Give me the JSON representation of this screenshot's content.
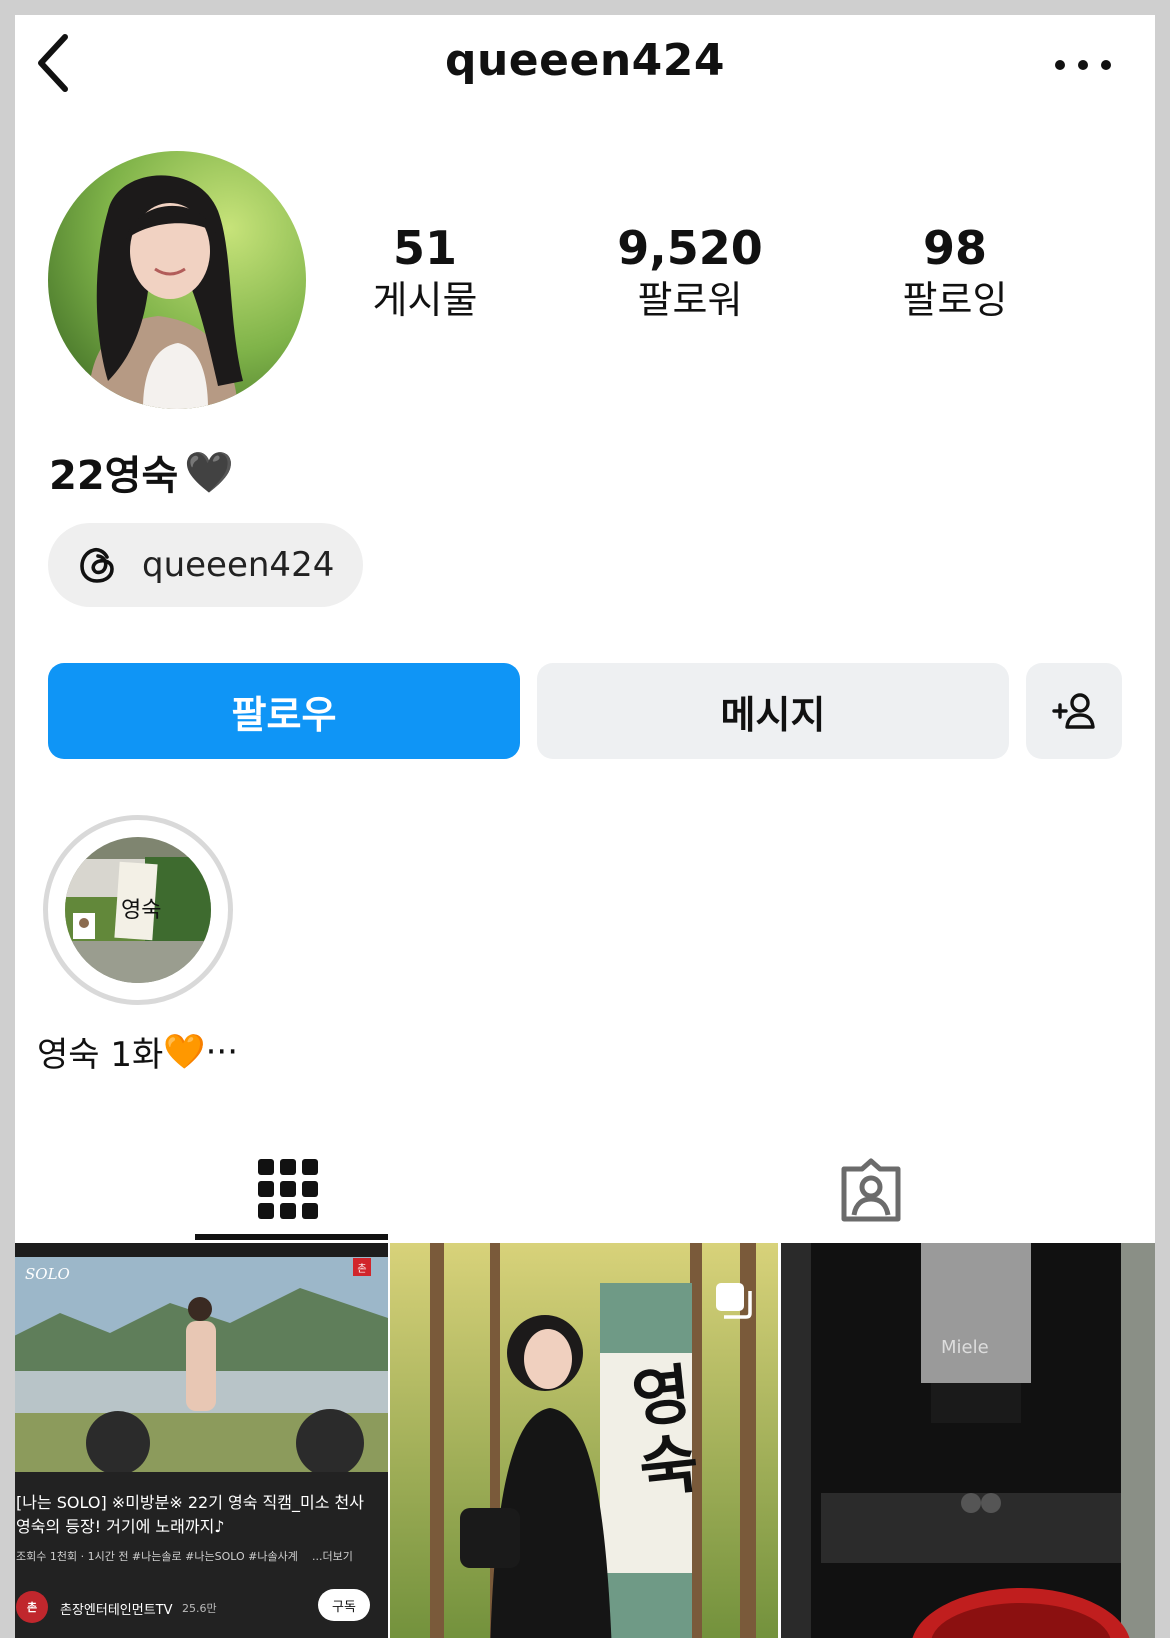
{
  "header": {
    "username": "queeen424"
  },
  "stats": [
    {
      "value": "51",
      "label": "게시물"
    },
    {
      "value": "9,520",
      "label": "팔로워"
    },
    {
      "value": "98",
      "label": "팔로잉"
    }
  ],
  "profile": {
    "display_name": "22영숙",
    "name_emoji": "🖤",
    "threads_handle": "queeen424"
  },
  "actions": {
    "follow_label": "팔로우",
    "message_label": "메시지"
  },
  "highlight": {
    "label": "영숙 1화",
    "emoji": "🧡",
    "ellipsis": "···",
    "signboard_text": "영숙"
  },
  "posts": [
    {
      "type": "video-screenshot",
      "show_logo": "SOLO",
      "channel_badge": "촌",
      "title": "[나는 SOLO] ※미방분※ 22기 영숙 직캠_미소 천사 영숙의 등장! 거기에 노래까지♪",
      "meta": "조회수 1천회 · 1시간 전   #나는솔로 #나는SOLO #나솔사계",
      "more": "...더보기",
      "channel_logo": "촌",
      "channel_name": "촌장엔터테인먼트TV",
      "subscribers": "25.6만",
      "subscribe_label": "구독"
    },
    {
      "type": "carousel",
      "banner_text": "영숙"
    },
    {
      "type": "photo",
      "brand_text": "Miele"
    }
  ],
  "colors": {
    "follow_blue": "#0f95f6",
    "button_gray": "#eef0f2",
    "pill_gray": "#efefef"
  }
}
